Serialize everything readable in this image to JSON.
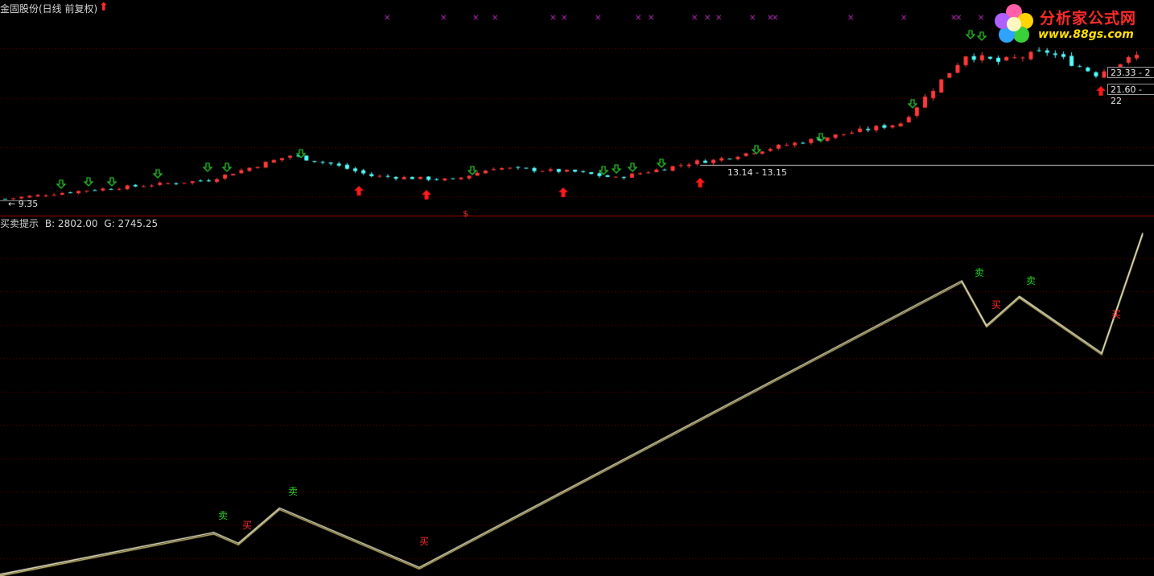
{
  "header": {
    "stock_title": "金固股份(日线 前复权)",
    "price_low_label": "9.35",
    "price_mid_label": "13.14 - 13.15",
    "price_box_1": "23.33 - 2",
    "price_box_2": "21.60 - 22"
  },
  "indicator": {
    "name": "买卖提示",
    "b_value": "B: 2802.00",
    "g_value": "G: 2745.25",
    "sell_label": "卖",
    "buy_label": "买"
  },
  "logo": {
    "name": "分析家公式网",
    "url": "www.88gs.com"
  },
  "colors": {
    "up": "#ff3a3a",
    "down": "#54ffff",
    "grid": "#7a0000",
    "sell": "#22d022",
    "buy": "#ff2a2a",
    "line": "#ffffe0",
    "marker": "#c030c0"
  },
  "chart_data": [
    {
      "type": "candlestick",
      "x_count": 140,
      "close_path": [
        [
          0,
          9.35
        ],
        [
          10,
          10.2
        ],
        [
          25,
          11.2
        ],
        [
          35,
          13.6
        ],
        [
          40,
          12.8
        ],
        [
          45,
          11.6
        ],
        [
          55,
          11.2
        ],
        [
          60,
          12.4
        ],
        [
          70,
          12.0
        ],
        [
          75,
          11.4
        ],
        [
          85,
          13.0
        ],
        [
          87,
          13.14
        ],
        [
          95,
          14.5
        ],
        [
          110,
          16.8
        ],
        [
          118,
          23.5
        ],
        [
          122,
          22.8
        ],
        [
          128,
          23.8
        ],
        [
          134,
          21.6
        ],
        [
          139,
          23.4
        ]
      ]
    },
    {
      "type": "line",
      "x": [
        0,
        26,
        29,
        34,
        51,
        117,
        120,
        124,
        134,
        139
      ],
      "y": [
        0,
        0.143,
        0.106,
        0.226,
        0.024,
        1.0,
        0.848,
        0.947,
        0.754,
        1.163
      ]
    }
  ]
}
